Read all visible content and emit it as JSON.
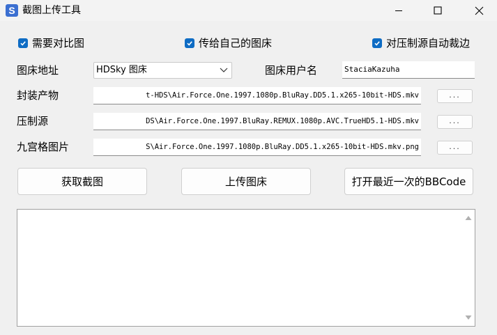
{
  "window": {
    "title": "截图上传工具",
    "icon_letter": "S",
    "icon_color": "#3b6fd1"
  },
  "options": {
    "need_compare": {
      "label": "需要对比图",
      "checked": true
    },
    "upload_own_host": {
      "label": "传给自己的图床",
      "checked": true
    },
    "auto_crop": {
      "label": "对压制源自动裁边",
      "checked": true
    }
  },
  "host": {
    "label": "图床地址",
    "selected": "HDSky 图床",
    "user_label": "图床用户名",
    "user_value": "StaciaKazuha"
  },
  "files": {
    "encode_label": "封装产物",
    "encode_path": "t-HDS\\Air.Force.One.1997.1080p.BluRay.DD5.1.x265-10bit-HDS.mkv",
    "source_label": "压制源",
    "source_path": "DS\\Air.Force.One.1997.BluRay.REMUX.1080p.AVC.TrueHD5.1-HDS.mkv",
    "grid_label": "九宫格图片",
    "grid_path": "S\\Air.Force.One.1997.1080p.BluRay.DD5.1.x265-10bit-HDS.mkv.png",
    "browse_label": "..."
  },
  "actions": {
    "capture": "获取截图",
    "upload": "上传图床",
    "open_bbcode": "打开最近一次的BBCode"
  },
  "output": {
    "value": ""
  },
  "colors": {
    "accent": "#0e6cc4",
    "background": "#f0f0f0"
  }
}
